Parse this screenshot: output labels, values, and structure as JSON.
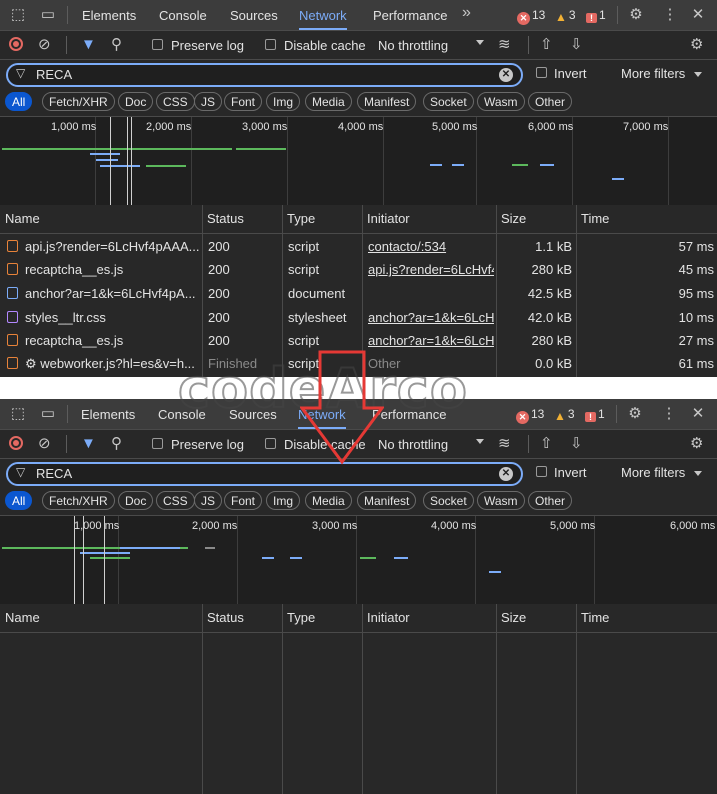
{
  "tabs": [
    "Elements",
    "Console",
    "Sources",
    "Network",
    "Performance"
  ],
  "active_tab": "Network",
  "counters": {
    "errors": "13",
    "warnings": "3",
    "messages": "1"
  },
  "toolbar": {
    "preserve_log": "Preserve log",
    "disable_cache": "Disable cache",
    "throttling": "No throttling"
  },
  "filter": {
    "value": "RECA",
    "invert": "Invert",
    "more_filters": "More filters"
  },
  "chips": [
    "All",
    "Fetch/XHR",
    "Doc",
    "CSS",
    "JS",
    "Font",
    "Img",
    "Media",
    "Manifest",
    "Socket",
    "Wasm",
    "Other"
  ],
  "top": {
    "overview_ticks": [
      "1,000 ms",
      "2,000 ms",
      "3,000 ms",
      "4,000 ms",
      "5,000 ms",
      "6,000 ms",
      "7,000 ms"
    ],
    "columns": [
      "Name",
      "Status",
      "Type",
      "Initiator",
      "Size",
      "Time"
    ],
    "rows": [
      {
        "name": "api.js?render=6LcHvf4pAAA...",
        "status": "200",
        "type": "script",
        "initiator": "contacto/:534",
        "size": "1.1 kB",
        "time": "57 ms"
      },
      {
        "name": "recaptcha__es.js",
        "status": "200",
        "type": "script",
        "initiator": "api.js?render=6LcHvf4",
        "size": "280 kB",
        "time": "45 ms"
      },
      {
        "name": "anchor?ar=1&k=6LcHvf4pA...",
        "status": "200",
        "type": "document",
        "initiator": "",
        "size": "42.5 kB",
        "time": "95 ms"
      },
      {
        "name": "styles__ltr.css",
        "status": "200",
        "type": "stylesheet",
        "initiator": "anchor?ar=1&k=6LcH",
        "size": "42.0 kB",
        "time": "10 ms"
      },
      {
        "name": "recaptcha__es.js",
        "status": "200",
        "type": "script",
        "initiator": "anchor?ar=1&k=6LcH",
        "size": "280 kB",
        "time": "27 ms"
      },
      {
        "name": "⚙ webworker.js?hl=es&v=h...",
        "status": "Finished",
        "type": "script",
        "initiator": "Other",
        "size": "0.0 kB",
        "time": "61 ms"
      }
    ]
  },
  "bottom": {
    "overview_ticks": [
      "1,000 ms",
      "2,000 ms",
      "3,000 ms",
      "4,000 ms",
      "5,000 ms",
      "6,000 ms"
    ],
    "columns": [
      "Name",
      "Status",
      "Type",
      "Initiator",
      "Size",
      "Time"
    ]
  },
  "watermark": "codeArco",
  "colors": {
    "accent": "#7cacf8",
    "chip_selected": "#0b57d0",
    "error": "#e46962",
    "warning": "#f2b134",
    "panel": "#282828",
    "arrow": "#e53935"
  }
}
